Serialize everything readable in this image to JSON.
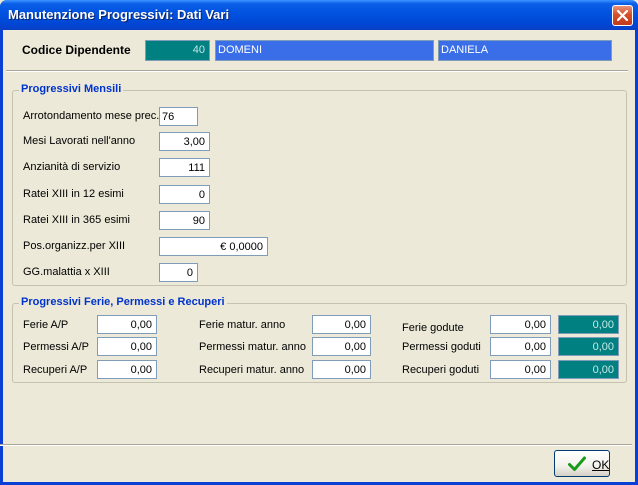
{
  "window": {
    "title": "Manutenzione Progressivi: Dati Vari"
  },
  "header": {
    "codice_label": "Codice Dipendente",
    "codice_value": "40",
    "cognome": "DOMENI",
    "nome": "DANIELA"
  },
  "mensili": {
    "title": "Progressivi Mensili",
    "rows": [
      {
        "label": "Arrotondamento mese prec.",
        "value": "76"
      },
      {
        "label": "Mesi Lavorati  nell'anno",
        "value": "3,00"
      },
      {
        "label": "Anzianità di servizio",
        "value": "111"
      },
      {
        "label": "Ratei XIII in 12 esimi",
        "value": "0"
      },
      {
        "label": "Ratei XIII in 365 esimi",
        "value": "90"
      },
      {
        "label": "Pos.organizz.per XIII",
        "value": "€ 0,0000"
      },
      {
        "label": "GG.malattia x XIII",
        "value": "0"
      }
    ]
  },
  "ferie": {
    "title": "Progressivi Ferie, Permessi e Recuperi",
    "rows": [
      {
        "label_ap": "Ferie A/P",
        "value_ap": "0,00",
        "label_matur": "Ferie matur. anno",
        "value_matur": "0,00",
        "label_goduti": "Ferie godute",
        "value_goduti": "0,00",
        "value_residuo": "0,00"
      },
      {
        "label_ap": "Permessi A/P",
        "value_ap": "0,00",
        "label_matur": "Permessi matur. anno",
        "value_matur": "0,00",
        "label_goduti": "Permessi goduti",
        "value_goduti": "0,00",
        "value_residuo": "0,00"
      },
      {
        "label_ap": "Recuperi A/P",
        "value_ap": "0,00",
        "label_matur": "Recuperi matur. anno",
        "value_matur": "0,00",
        "label_goduti": "Recuperi goduti",
        "value_goduti": "0,00",
        "value_residuo": "0,00"
      }
    ]
  },
  "footer": {
    "ok_label": "OK"
  },
  "colors": {
    "titlebar": "#0046d5",
    "group_title": "#0033cc",
    "teal": "#008080",
    "blue_field": "#3a6ee8",
    "window_bg": "#ece9d8"
  },
  "icons": {
    "close": "close-icon",
    "ok": "checkmark-icon"
  }
}
